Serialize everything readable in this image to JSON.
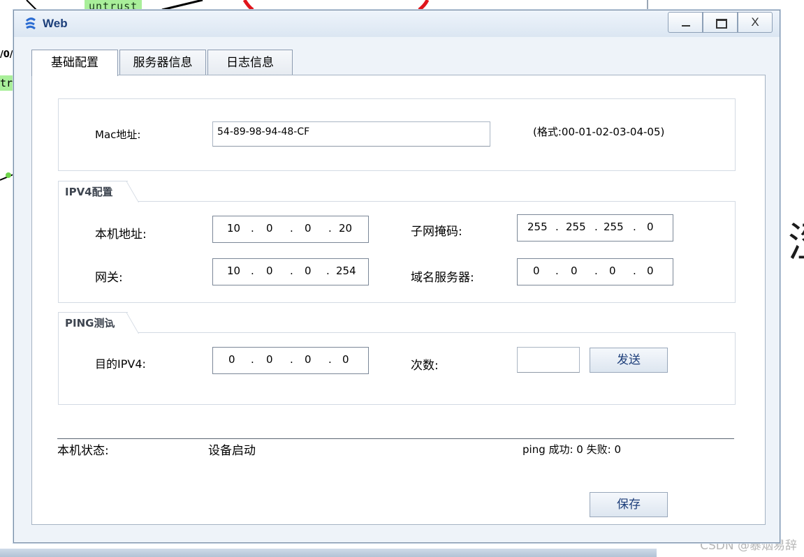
{
  "background": {
    "zone_label": "untrust",
    "port_label": "/0/",
    "side_label": "tr",
    "watermark": "CSDN @暴烟易辞",
    "glyph": "涩"
  },
  "window": {
    "title": "Web",
    "buttons": {
      "close": "X"
    }
  },
  "tabs": [
    {
      "label": "基础配置",
      "active": true
    },
    {
      "label": "服务器信息",
      "active": false
    },
    {
      "label": "日志信息",
      "active": false
    }
  ],
  "mac": {
    "label": "Mac地址:",
    "value": "54-89-98-94-48-CF",
    "hint": "(格式:00-01-02-03-04-05)"
  },
  "ipv4": {
    "section_title": "IPV4配置",
    "local_address": {
      "label": "本机地址:",
      "octets": [
        "10",
        "0",
        "0",
        "20"
      ]
    },
    "subnet_mask": {
      "label": "子网掩码:",
      "octets": [
        "255",
        "255",
        "255",
        "0"
      ]
    },
    "gateway": {
      "label": "网关:",
      "octets": [
        "10",
        "0",
        "0",
        "254"
      ]
    },
    "dns": {
      "label": "域名服务器:",
      "octets": [
        "0",
        "0",
        "0",
        "0"
      ]
    }
  },
  "ping": {
    "section_title": "PING测试",
    "target": {
      "label": "目的IPV4:",
      "octets": [
        "0",
        "0",
        "0",
        "0"
      ]
    },
    "count": {
      "label": "次数:",
      "value": ""
    },
    "send_label": "发送"
  },
  "status": {
    "label": "本机状态:",
    "value": "设备启动",
    "ping_result": "ping 成功: 0 失败: 0"
  },
  "save_label": "保存",
  "colors": {
    "title_text": "#1c3f7a",
    "button_text": "#1d3e7a",
    "window_bg": "#eef3f9"
  }
}
